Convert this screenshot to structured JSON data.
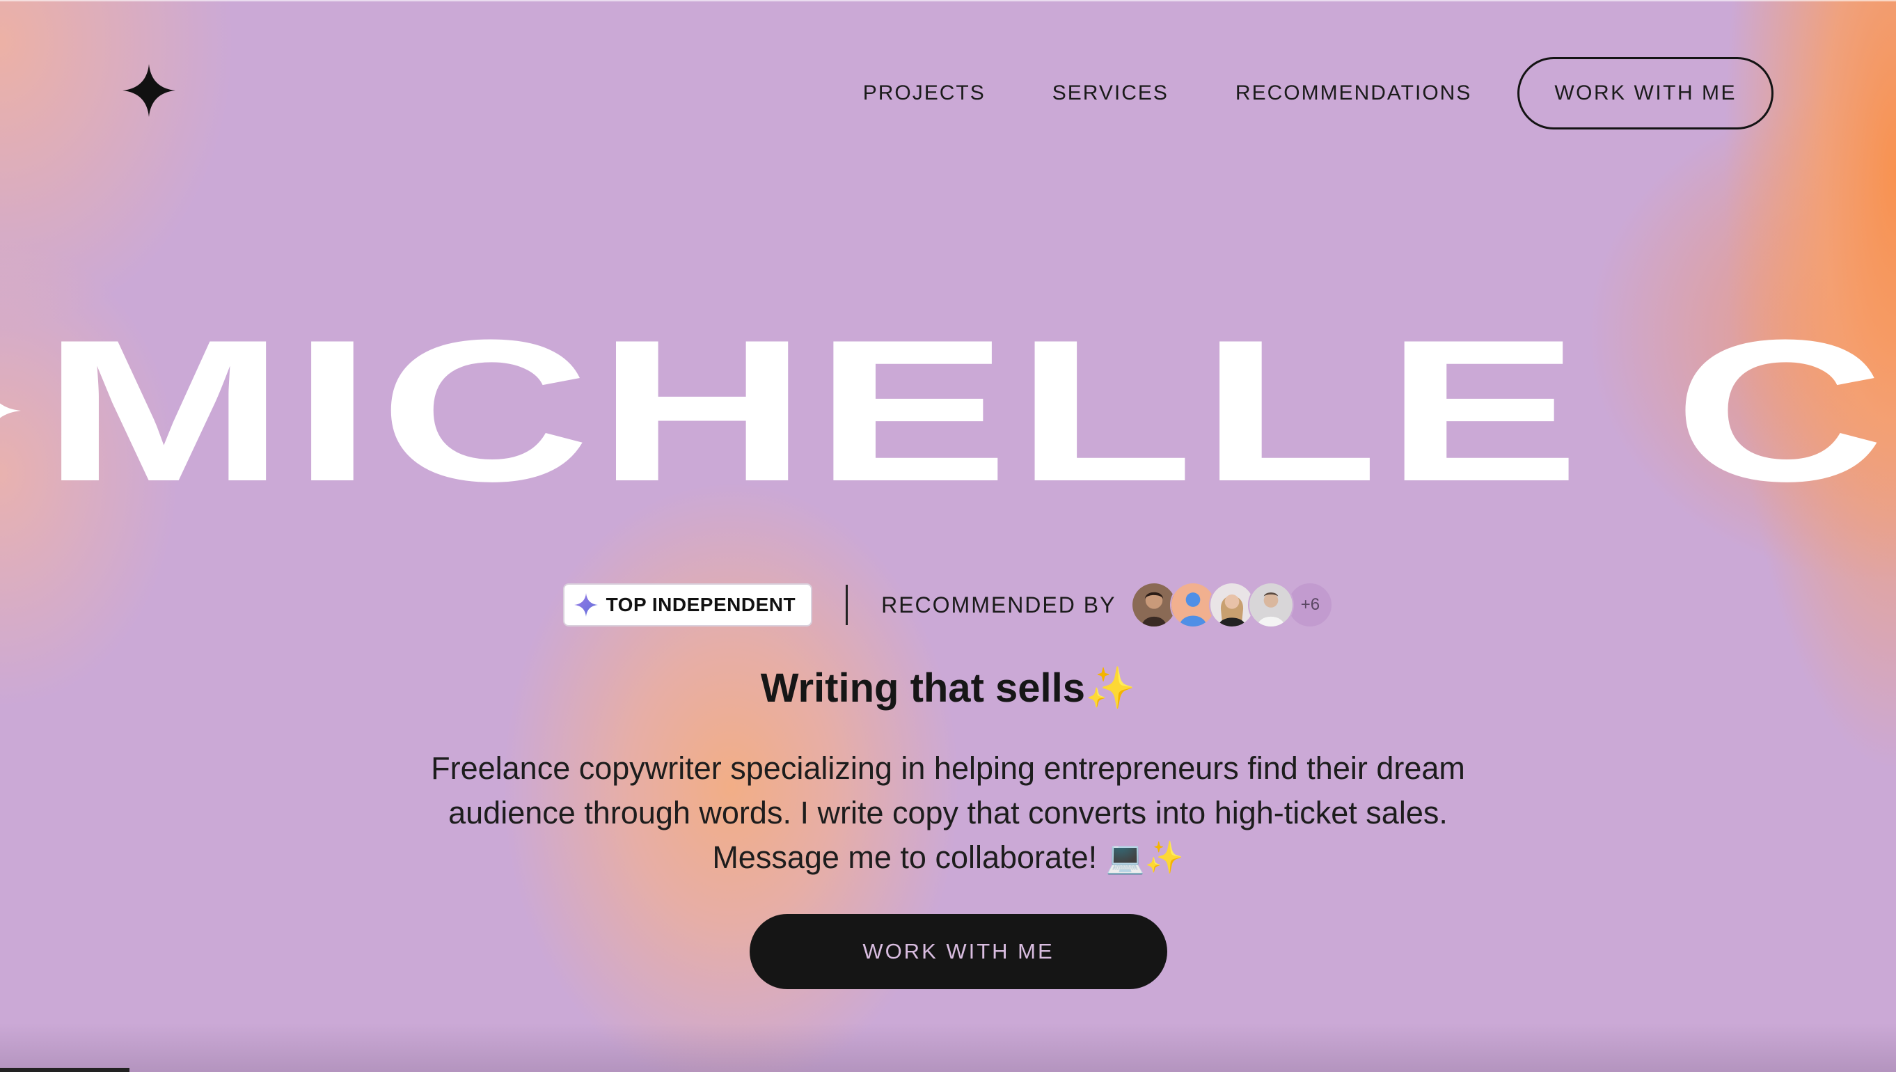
{
  "header": {
    "logo_icon": "four-point-star-icon",
    "nav": [
      {
        "label": "PROJECTS"
      },
      {
        "label": "SERVICES"
      },
      {
        "label": "RECOMMENDATIONS"
      }
    ],
    "cta_label": "WORK WITH ME"
  },
  "hero": {
    "marquee_name": "MICHELLE C",
    "badge": {
      "icon": "sparkle-icon",
      "label": "TOP INDEPENDENT"
    },
    "recommended_label": "RECOMMENDED BY",
    "avatars_more": "+6",
    "headline": "Writing that sells✨",
    "description": "Freelance copywriter specializing in helping entrepreneurs find their dream audience through words. I write copy that converts into high-ticket sales. Message me to collaborate! 💻✨",
    "cta_label": "WORK WITH ME"
  },
  "colors": {
    "background": "#cba9d6",
    "accent_orange": "#f8924f",
    "text": "#1a1a1a",
    "button_dark": "#151515"
  }
}
